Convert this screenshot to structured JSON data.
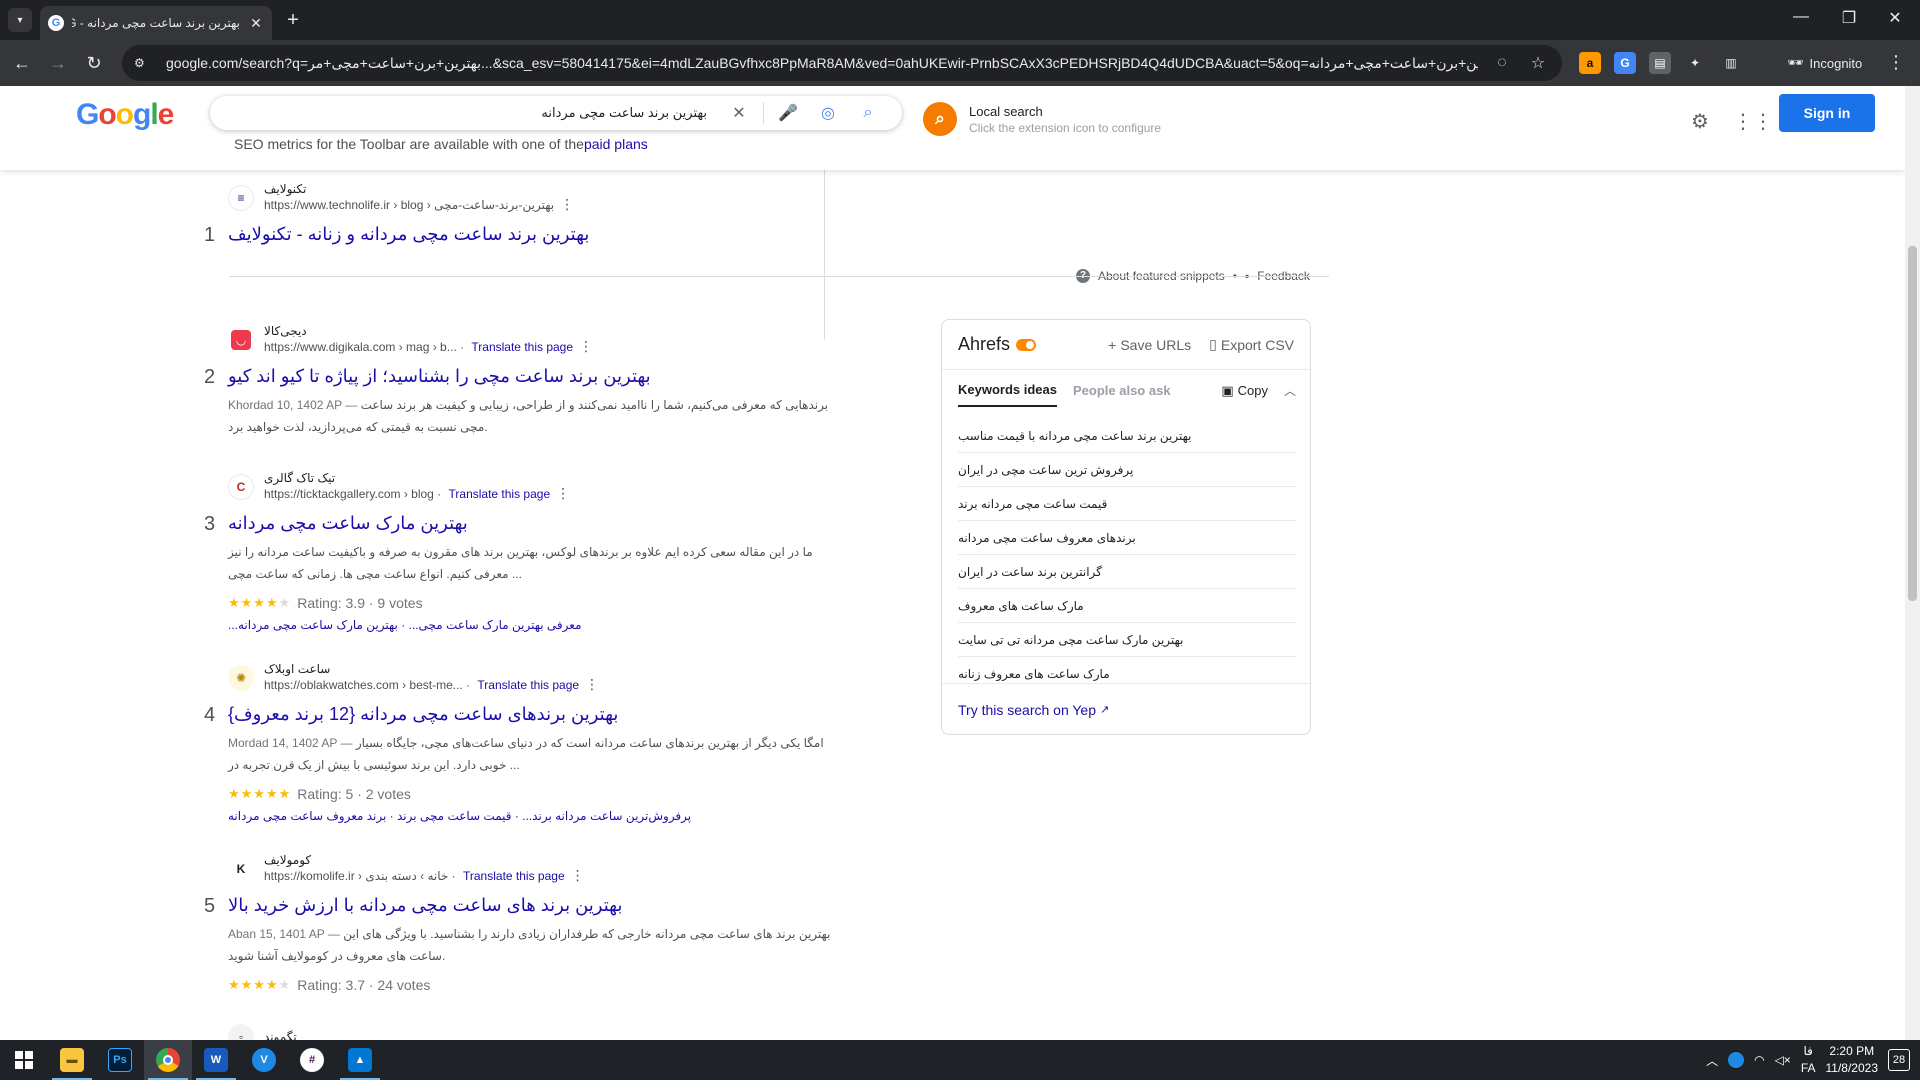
{
  "browser": {
    "tab_title": "بهترین برند ساعت مچی مردانه - G",
    "new_tab": "+",
    "url": "google.com/search?q=بهترین+برن+ساعت+مچی+مر...&sca_esv=580414175&ei=4mdLZauBGvfhxc8PpMaR8AM&ved=0ahUKEwir-PrnbSCAxX3cPEDHSRjBD4Q4dUDCBA&uact=5&oq=بهترین+برن+ساعت+مچی+مردانه",
    "incognito_label": "Incognito"
  },
  "header": {
    "logo_letters": [
      "G",
      "o",
      "o",
      "g",
      "l",
      "e"
    ],
    "query": "بهترین برند ساعت مچی مردانه",
    "seo_prefix": "SEO metrics for the Toolbar are available with one of the",
    "seo_link": "paid plans",
    "local_search_title": "Local search",
    "local_search_sub": "Click the extension icon to configure",
    "signin": "Sign in"
  },
  "snippet": {
    "about": "About featured snippets",
    "feedback": "Feedback"
  },
  "results": [
    {
      "num": "1",
      "site": "تکنولایف",
      "url": "https://www.technolife.ir › blog › بهترین-برند-ساعت-مچی",
      "translate": "",
      "title": "بهترین برند ساعت مچی مردانه و زنانه - تکنولایف",
      "date": "",
      "snippet": "",
      "rating": "",
      "sitelinks": ""
    },
    {
      "num": "2",
      "site": "دیجی‌کالا",
      "url": "https://www.digikala.com › mag › b...",
      "translate": "Translate this page",
      "title": "بهترین برند ساعت مچی را بشناسید؛ از پیاژه تا کیو اند کیو",
      "date": "Khordad 10, 1402 AP —",
      "snippet": "برندهایی که معرفی می‌کنیم، شما را ناامید نمی‌کنند و از طراحی، زیبایی و کیفیت هر برند ساعت مچی نسبت به قیمتی که می‌پردازید، لذت خواهید برد.",
      "rating": "",
      "sitelinks": ""
    },
    {
      "num": "3",
      "site": "تیک تاک گالری",
      "url": "https://ticktackgallery.com › blog",
      "translate": "Translate this page",
      "title": "بهترین مارک ساعت مچی مردانه",
      "date": "",
      "snippet": "ما در این مقاله سعی کرده ایم علاوه بر برندهای لوکس، بهترین برند های مقرون به صرفه و باکیفیت ساعت مردانه را نیز معرفی کنیم. انواع ساعت مچی ها. زمانی که ساعت مچی ...",
      "rating": "Rating: 3.9 · 9 votes",
      "sitelinks": "معرفی بهترین مارک ساعت مچی... · بهترین مارک ساعت مچی مردانه..."
    },
    {
      "num": "4",
      "site": "ساعت اوبلاک",
      "url": "https://oblakwatches.com › best-me...",
      "translate": "Translate this page",
      "title": "بهترین برندهای ساعت مچی مردانه {12 برند معروف}",
      "date": "Mordad 14, 1402 AP —",
      "snippet": "امگا یکی دیگر از بهترین برندهای ساعت مردانه است که در دنیای ساعت‌های مچی، جایگاه بسیار خوبی دارد. این برند سوئیسی با بیش از یک قرن تجربه در ...",
      "rating": "Rating: 5 · 2 votes",
      "sitelinks": "پرفروش‌ترین ساعت مردانه برند... · قیمت ساعت مچی برند · برند معروف ساعت مچی مردانه"
    },
    {
      "num": "5",
      "site": "کومولایف",
      "url": "https://komolife.ir › خانه › دسته بندی",
      "translate": "Translate this page",
      "title": "بهترین برند های ساعت مچی مردانه با ارزش خرید بالا",
      "date": "Aban 15, 1401 AP —",
      "snippet": "بهترین برند های ساعت مچی مردانه خارجی که طرفداران زیادی دارند را بشناسید. با ویژگی های این ساعت های معروف در کومولایف آشنا شوید.",
      "rating": "Rating: 3.7 · 24 votes",
      "sitelinks": ""
    }
  ],
  "next_result_site": "تگموند",
  "ahrefs": {
    "brand": "Ahrefs",
    "save_urls": "Save URLs",
    "export_csv": "Export CSV",
    "tab_keywords": "Keywords ideas",
    "tab_people": "People also ask",
    "copy": "Copy",
    "keywords": [
      "بهترین برند ساعت مچی مردانه با قیمت مناسب",
      "پرفروش ترین ساعت مچی در ایران",
      "قیمت ساعت مچی مردانه برند",
      "برندهای معروف ساعت مچی مردانه",
      "گرانترین برند ساعت در ایران",
      "مارک ساعت های معروف",
      "بهترین مارک ساعت مچی مردانه تی تی سایت",
      "مارک ساعت های معروف زنانه"
    ],
    "try_yep": "Try this search on Yep"
  },
  "taskbar": {
    "apps": [
      "File Explorer",
      "Photoshop",
      "Chrome",
      "Word",
      "Vivaldi",
      "Slack",
      "Photos"
    ],
    "lang_top": "فا",
    "lang_bottom": "FA",
    "time": "2:20 PM",
    "date": "11/8/2023",
    "notifications": "28"
  }
}
